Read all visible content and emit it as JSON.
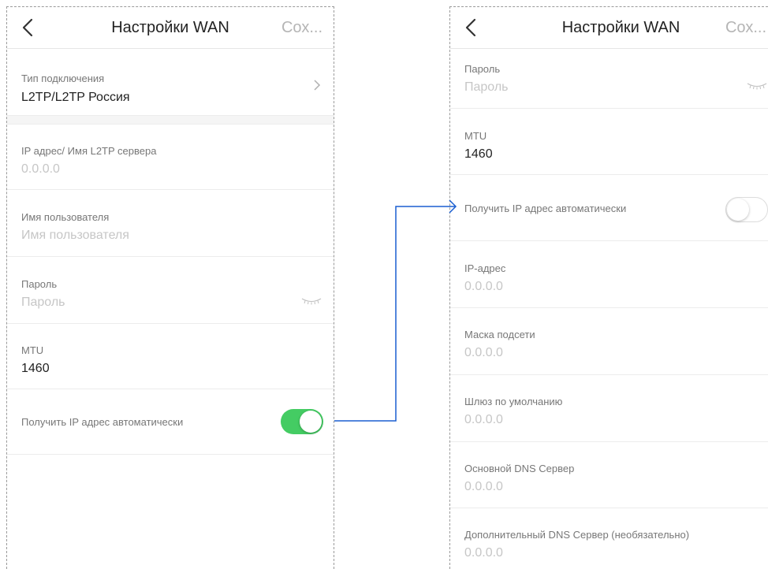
{
  "left_screen": {
    "header": {
      "title": "Настройки WAN",
      "save_label": "Сох..."
    },
    "connection_type": {
      "label": "Тип подключения",
      "value": "L2TP/L2TP Россия"
    },
    "server": {
      "label": "IP адрес/ Имя L2TP сервера",
      "placeholder": "0.0.0.0"
    },
    "username": {
      "label": "Имя пользователя",
      "placeholder": "Имя пользователя"
    },
    "password": {
      "label": "Пароль",
      "placeholder": "Пароль"
    },
    "mtu": {
      "label": "MTU",
      "value": "1460"
    },
    "auto_ip": {
      "label": "Получить IP адрес автоматически",
      "enabled": true
    }
  },
  "right_screen": {
    "header": {
      "title": "Настройки WAN",
      "save_label": "Сох..."
    },
    "password": {
      "label": "Пароль",
      "placeholder": "Пароль"
    },
    "mtu": {
      "label": "MTU",
      "value": "1460"
    },
    "auto_ip": {
      "label": "Получить IP адрес автоматически",
      "enabled": false
    },
    "ip_address": {
      "label": "IP-адрес",
      "placeholder": "0.0.0.0"
    },
    "subnet_mask": {
      "label": "Маска подсети",
      "placeholder": "0.0.0.0"
    },
    "gateway": {
      "label": "Шлюз по умолчанию",
      "placeholder": "0.0.0.0"
    },
    "primary_dns": {
      "label": "Основной DNS Сервер",
      "placeholder": "0.0.0.0"
    },
    "secondary_dns": {
      "label": "Дополнительный DNS Сервер (необязательно)",
      "placeholder": "0.0.0.0"
    }
  },
  "colors": {
    "toggle_on": "#44cc63",
    "connector_arrow": "#1a5fd1",
    "placeholder_text": "#c6c6c6"
  },
  "icons": [
    "back-chevron-icon",
    "chevron-right-icon",
    "eye-closed-icon",
    "arrow-right-icon"
  ]
}
